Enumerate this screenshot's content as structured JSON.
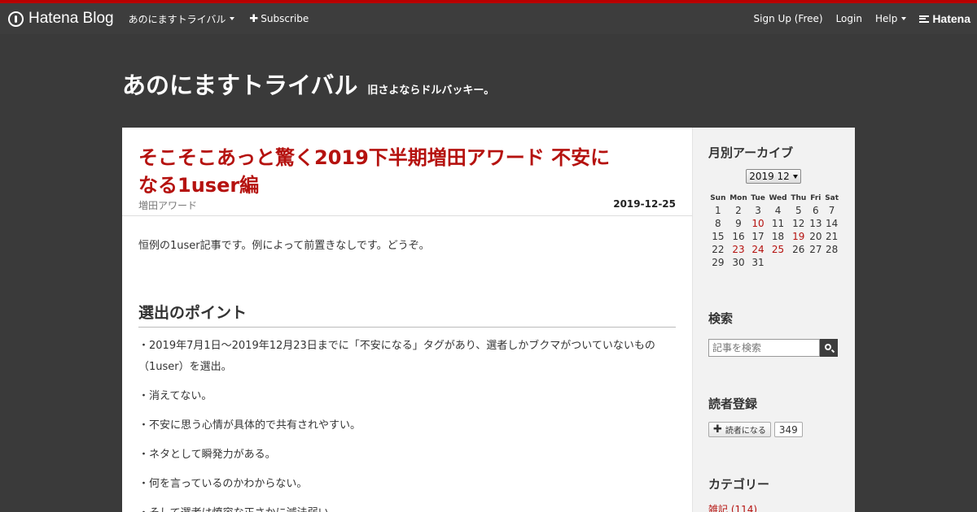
{
  "globalbar": {
    "logo": "Hatena Blog",
    "blog_menu": "あのにますトライバル",
    "subscribe": "Subscribe",
    "signup": "Sign Up (Free)",
    "login": "Login",
    "help": "Help",
    "hatena": "Hatena",
    "accent_color": "#b80000"
  },
  "blog": {
    "title": "あのにますトライバル",
    "description": "旧さよならドルバッキー。"
  },
  "entry": {
    "title": "そこそこあっと驚く2019下半期増田アワード 不安になる1user編",
    "category": "増田アワード",
    "date": "2019-12-25",
    "intro": "恒例の1user記事です。例によって前置きなしです。どうぞ。",
    "section_heading": "選出のポイント",
    "points": [
      "・2019年7月1日～2019年12月23日までに「不安になる」タグがあり、選者しかブクマがついていないもの（1user）を選出。",
      "・消えてない。",
      "・不安に思う心情が具体的で共有されやすい。",
      "・ネタとして瞬発力がある。",
      "・何を言っているのかわからない。",
      "・そして選者は慎容な正さかに減法弱い"
    ],
    "title_color": "#b5120f"
  },
  "sidebar": {
    "archive": {
      "title": "月別アーカイブ",
      "selected": "2019 12",
      "weekdays": [
        "Sun",
        "Mon",
        "Tue",
        "Wed",
        "Thu",
        "Fri",
        "Sat"
      ],
      "weeks": [
        [
          "1",
          "2",
          "3",
          "4",
          "5",
          "6",
          "7"
        ],
        [
          "8",
          "9",
          "10",
          "11",
          "12",
          "13",
          "14"
        ],
        [
          "15",
          "16",
          "17",
          "18",
          "19",
          "20",
          "21"
        ],
        [
          "22",
          "23",
          "24",
          "25",
          "26",
          "27",
          "28"
        ],
        [
          "29",
          "30",
          "31",
          "",
          "",
          "",
          ""
        ]
      ],
      "posted_days": [
        "10",
        "19",
        "23",
        "24",
        "25"
      ]
    },
    "search": {
      "title": "検索",
      "placeholder": "記事を検索"
    },
    "subscribe": {
      "title": "読者登録",
      "button": "読者になる",
      "count": "349"
    },
    "categories": {
      "title": "カテゴリー",
      "first_item": "雑記 (114)"
    }
  }
}
